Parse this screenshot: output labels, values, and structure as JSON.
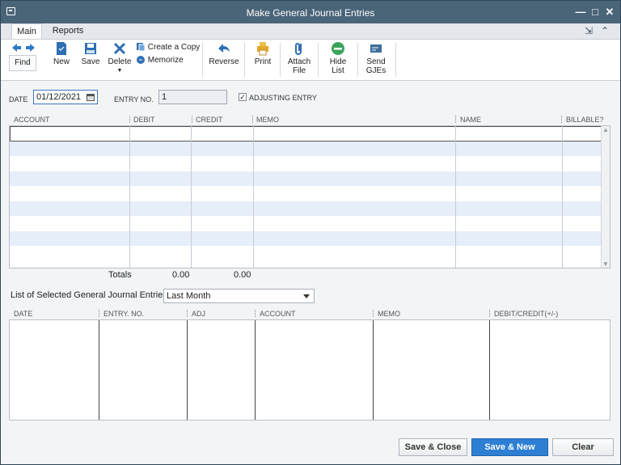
{
  "window": {
    "title": "Make General Journal Entries"
  },
  "tabs": [
    {
      "label": "Main"
    },
    {
      "label": "Reports"
    }
  ],
  "toolbar": {
    "find": "Find",
    "new": "New",
    "save": "Save",
    "delete": "Delete",
    "create_copy": "Create a Copy",
    "memorize": "Memorize",
    "reverse": "Reverse",
    "print": "Print",
    "attach_line1": "Attach",
    "attach_line2": "File",
    "hide_line1": "Hide",
    "hide_line2": "List",
    "send_line1": "Send",
    "send_line2": "GJEs"
  },
  "form": {
    "date_label": "Date",
    "date_value": "01/12/2021",
    "entry_no_label": "Entry No.",
    "entry_no_value": "1",
    "adjusting_label": "Adjusting Entry",
    "adjusting_checked": true
  },
  "entry_grid": {
    "columns": [
      "Account",
      "Debit",
      "Credit",
      "Memo",
      "Name",
      "Billable?"
    ],
    "totals_label": "Totals",
    "total_debit": "0.00",
    "total_credit": "0.00"
  },
  "list": {
    "label": "List of Selected General Journal Entries:",
    "filter_value": "Last Month",
    "columns": [
      "Date",
      "Entry. No.",
      "Adj",
      "Account",
      "Memo",
      "Debit/Credit(+/-)"
    ]
  },
  "footer": {
    "save_close": "Save & Close",
    "save_new": "Save & New",
    "clear": "Clear"
  },
  "colors": {
    "titlebar": "#4a6478",
    "accent": "#2d7fd3",
    "row_alt": "#e6eefa"
  },
  "icons": [
    "back-arrow-icon",
    "forward-arrow-icon",
    "new-doc-icon",
    "save-disk-icon",
    "delete-x-icon",
    "copy-icon",
    "memorize-icon",
    "reverse-arrow-icon",
    "printer-icon",
    "paperclip-icon",
    "hide-list-icon",
    "send-gje-icon",
    "calendar-icon"
  ]
}
